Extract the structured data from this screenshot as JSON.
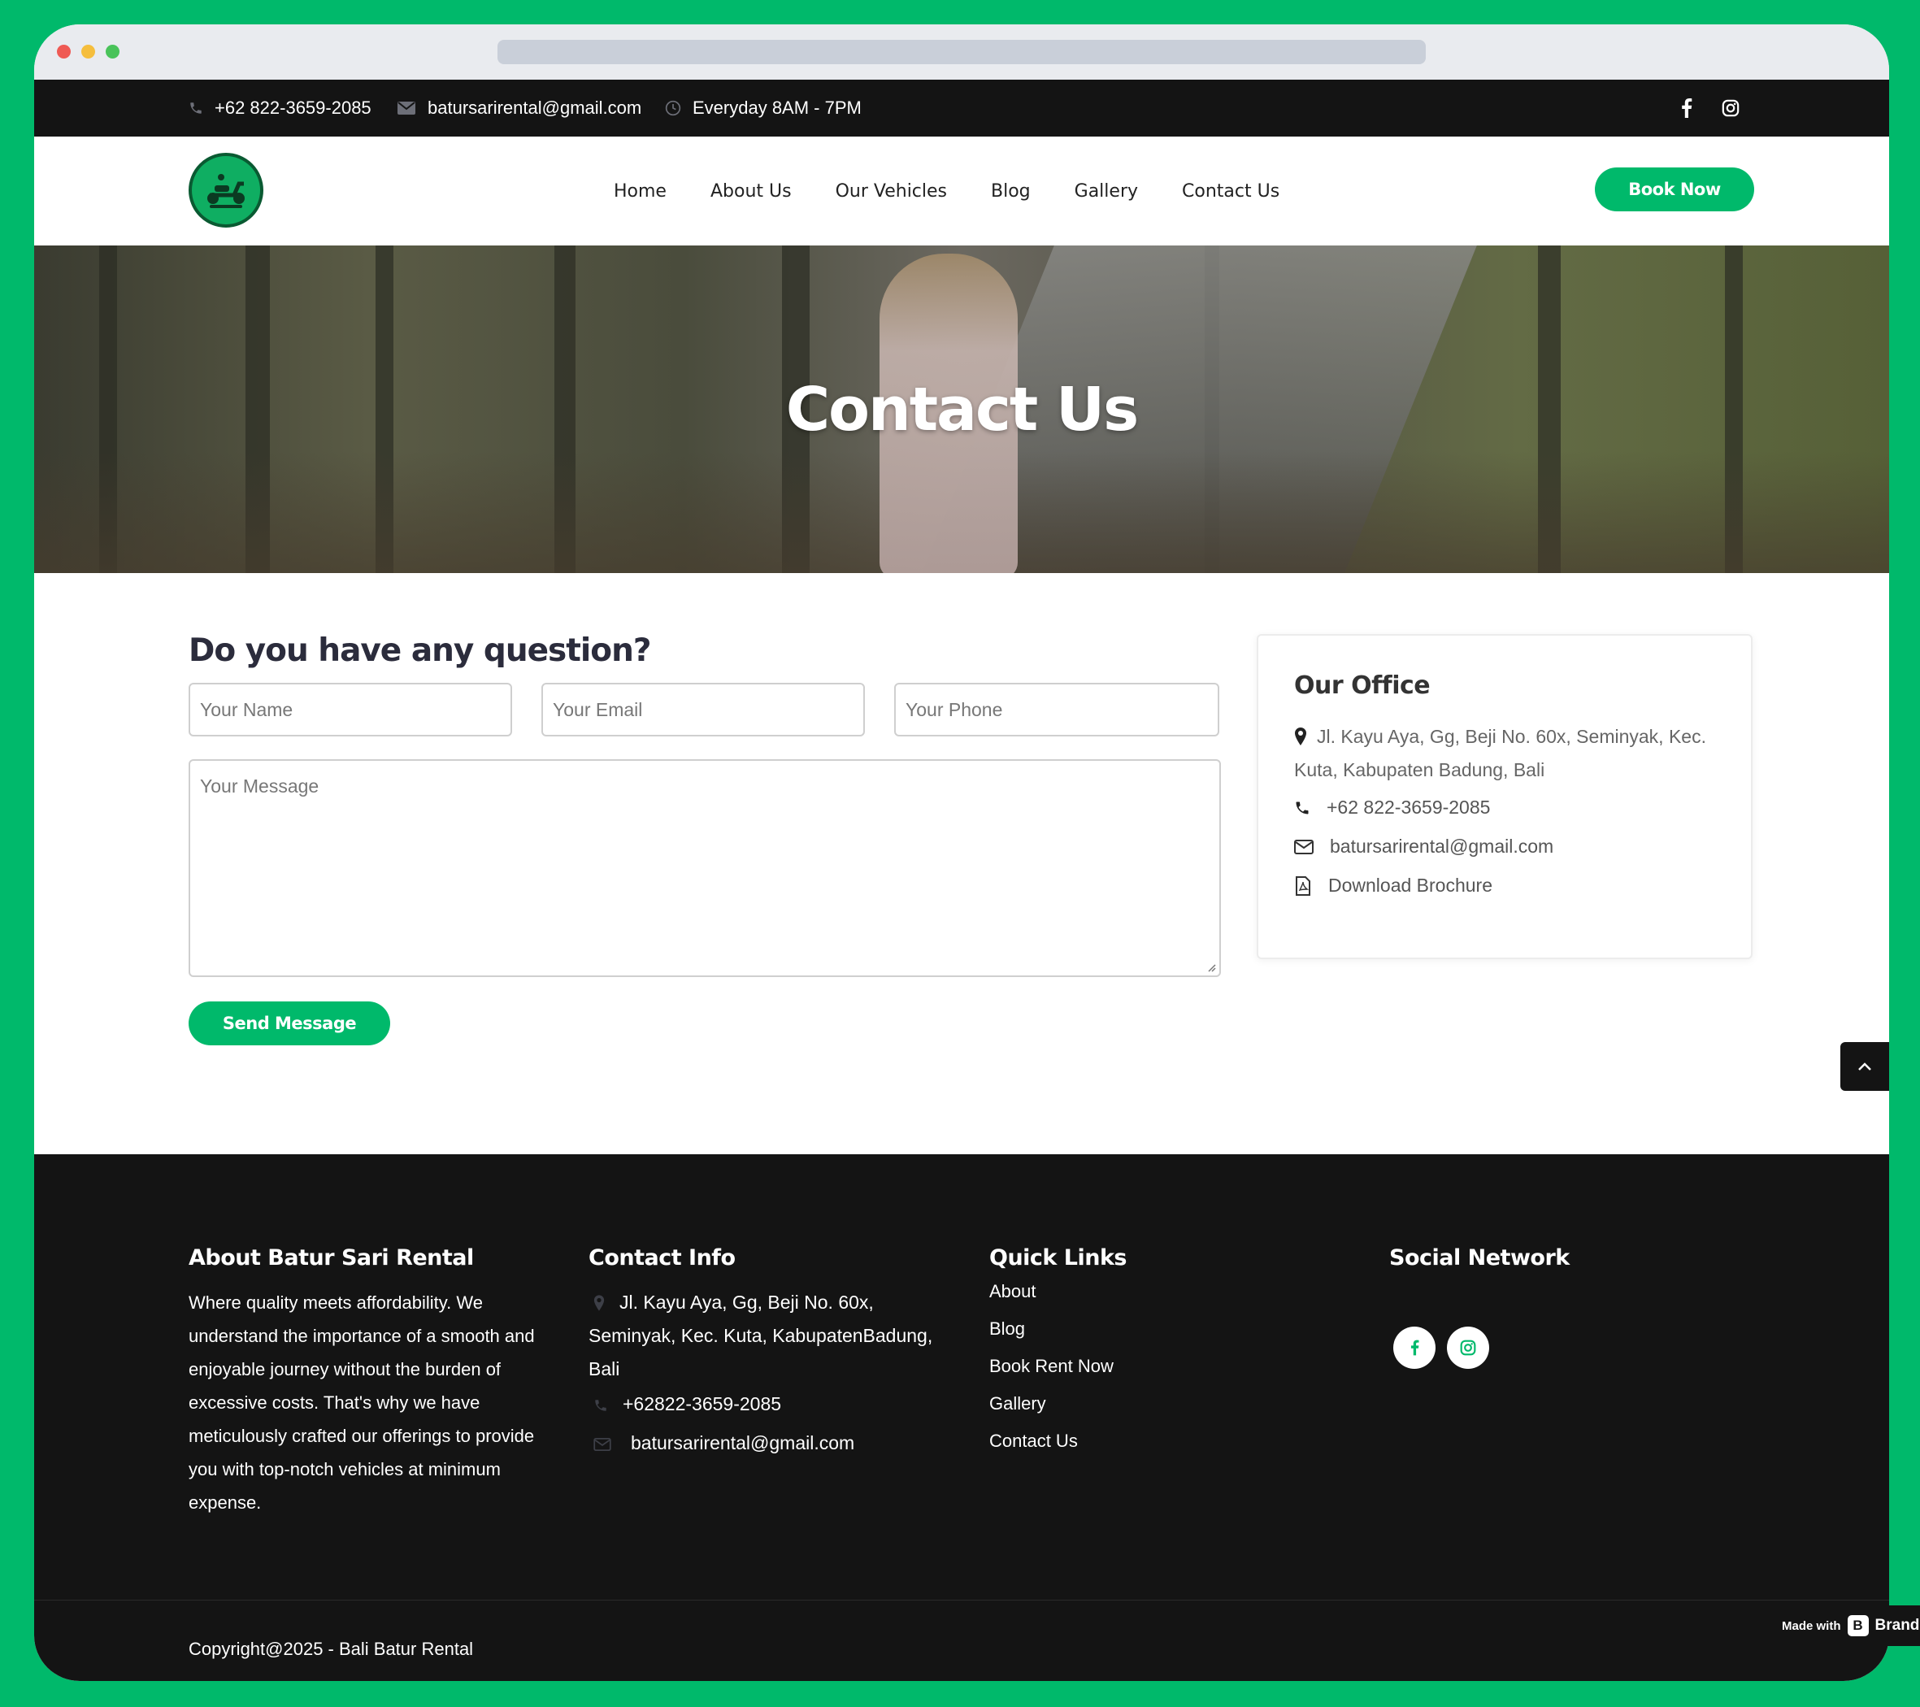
{
  "topbar": {
    "phone": "+62 822-3659-2085",
    "email": "batursarirental@gmail.com",
    "hours": "Everyday 8AM - 7PM"
  },
  "nav": {
    "items": [
      "Home",
      "About Us",
      "Our Vehicles",
      "Blog",
      "Gallery",
      "Contact Us"
    ],
    "book_label": "Book Now"
  },
  "hero": {
    "title": "Contact Us"
  },
  "form": {
    "title": "Do you have any question?",
    "name_placeholder": "Your Name",
    "email_placeholder": "Your Email",
    "phone_placeholder": "Your Phone",
    "message_placeholder": "Your Message",
    "send_label": "Send Message"
  },
  "office": {
    "title": "Our Office",
    "address": "Jl. Kayu Aya, Gg, Beji No. 60x, Seminyak, Kec. Kuta, Kabupaten Badung, Bali",
    "phone": "+62 822-3659-2085",
    "email": "batursarirental@gmail.com",
    "brochure": "Download Brochure"
  },
  "footer": {
    "about_title": "About Batur Sari Rental",
    "about_text": "Where quality meets affordability. We understand the importance of a smooth and enjoyable journey without the burden of excessive costs. That's why we have meticulously crafted our offerings to provide you with top-notch vehicles at minimum expense.",
    "contact_title": "Contact Info",
    "contact_address": "Jl. Kayu Aya, Gg, Beji No. 60x, Seminyak, Kec. Kuta, KabupatenBadung, Bali",
    "contact_phone": "+62822-3659-2085",
    "contact_email": "batursarirental@gmail.com",
    "links_title": "Quick Links",
    "links": [
      "About",
      "Blog",
      "Book Rent Now",
      "Gallery",
      "Contact Us"
    ],
    "social_title": "Social Network",
    "copyright": "Copyright@2025 - Bali Batur Rental"
  },
  "badge": {
    "made_with": "Made with",
    "brand": "Brand"
  },
  "colors": {
    "accent": "#00b96b",
    "dark": "#141414"
  }
}
